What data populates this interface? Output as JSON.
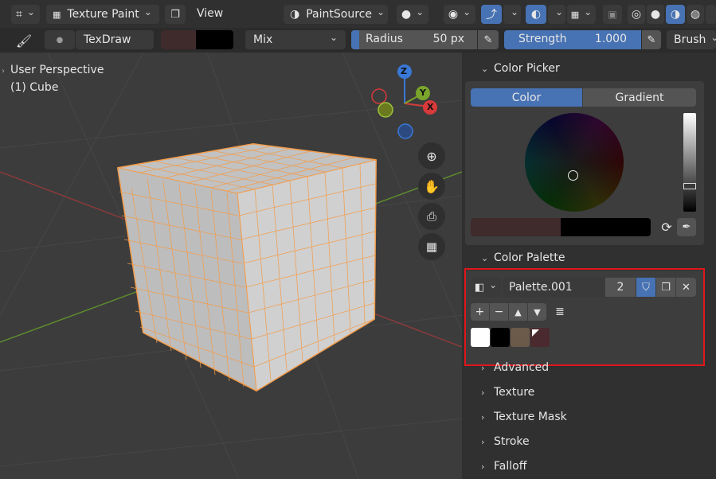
{
  "header": {
    "mode_label": "Texture Paint",
    "view_label": "View",
    "source_label": "PaintSource"
  },
  "toolbar": {
    "brush_name": "TexDraw",
    "blend_mode": "Mix",
    "radius_label": "Radius",
    "radius_value": "50 px",
    "strength_label": "Strength",
    "strength_value": "1.000",
    "brush_menu": "Brush"
  },
  "viewport": {
    "perspective": "User Perspective",
    "object": "(1) Cube",
    "axis_x": "X",
    "axis_y": "Y",
    "axis_z": "Z"
  },
  "sidebar": {
    "color_picker_title": "Color Picker",
    "tab_color": "Color",
    "tab_gradient": "Gradient",
    "color_palette_title": "Color Palette",
    "palette_name": "Palette.001",
    "palette_users": "2",
    "collapsed_panels": [
      "Advanced",
      "Texture",
      "Texture Mask",
      "Stroke",
      "Falloff"
    ]
  },
  "colors": {
    "accent": "#4772b3",
    "highlight_box": "#e0161b",
    "swatch_white": "#ffffff",
    "swatch_black": "#000000",
    "swatch_brown": "#6b5a4a",
    "swatch_dark_red": "#4a2a2e",
    "primary_color": "#3f2a2c",
    "secondary_color": "#000000"
  }
}
